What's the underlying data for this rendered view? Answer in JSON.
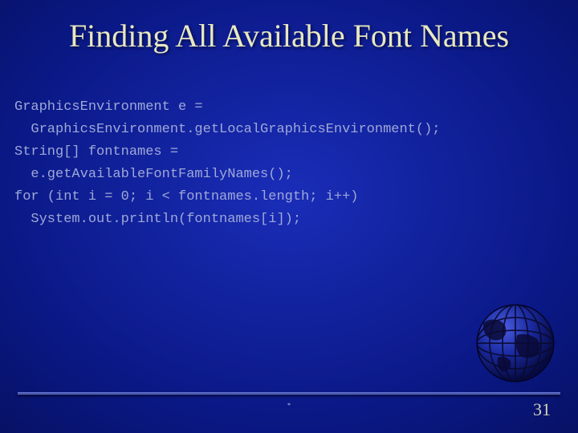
{
  "slide": {
    "title": "Finding All Available Font Names",
    "code_lines": [
      "GraphicsEnvironment e =",
      "  GraphicsEnvironment.getLocalGraphicsEnvironment();",
      "String[] fontnames =",
      "  e.getAvailableFontFamilyNames();",
      "for (int i = 0; i < fontnames.length; i++)",
      "  System.out.println(fontnames[i]);"
    ],
    "page_number": "31",
    "footer_mark": "*"
  }
}
